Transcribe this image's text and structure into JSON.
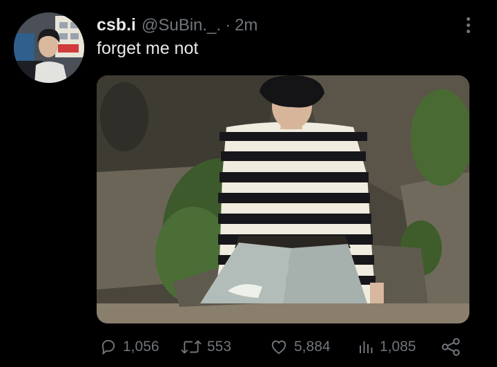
{
  "tweet": {
    "display_name": "csb.i",
    "handle": "@SuBin._.",
    "separator": "·",
    "time": "2m",
    "text": "forget me not"
  },
  "actions": {
    "replies": "1,056",
    "retweets": "553",
    "likes": "5,884",
    "views": "1,085"
  },
  "icons": {
    "more": "more-vertical-icon",
    "reply": "reply-icon",
    "retweet": "retweet-icon",
    "like": "heart-icon",
    "views": "analytics-icon",
    "share": "share-icon"
  },
  "colors": {
    "background": "#000000",
    "primary_text": "#e7e9ea",
    "secondary_text": "#71767b"
  }
}
